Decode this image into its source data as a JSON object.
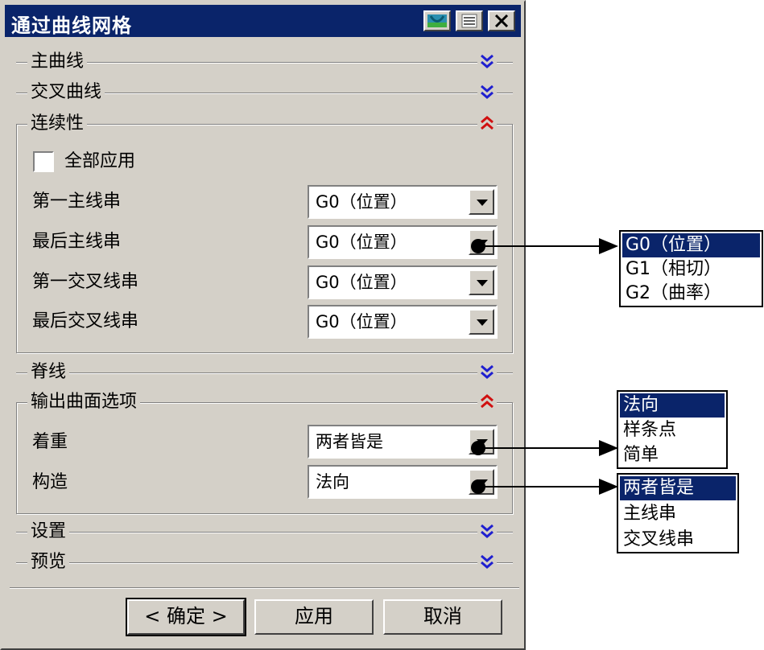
{
  "dialog": {
    "title": "通过曲线网格",
    "sections": {
      "primary": "主曲线",
      "cross": "交叉曲线",
      "continuity": "连续性",
      "spine": "脊线",
      "output": "输出曲面选项",
      "settings": "设置",
      "preview": "预览"
    },
    "continuity": {
      "apply_all_label": "全部应用",
      "apply_all_checked": false,
      "rows": [
        {
          "label": "第一主线串",
          "value": "G0（位置）"
        },
        {
          "label": "最后主线串",
          "value": "G0（位置）"
        },
        {
          "label": "第一交叉线串",
          "value": "G0（位置）"
        },
        {
          "label": "最后交叉线串",
          "value": "G0（位置）"
        }
      ]
    },
    "output": {
      "rows": [
        {
          "label": "着重",
          "value": "两者皆是"
        },
        {
          "label": "构造",
          "value": "法向"
        }
      ]
    },
    "buttons": {
      "ok": "< 确定 >",
      "apply": "应用",
      "cancel": "取消"
    }
  },
  "popups": {
    "continuity_options": [
      "G0（位置）",
      "G1（相切）",
      "G2（曲率）"
    ],
    "construction_options": [
      "法向",
      "样条点",
      "简单"
    ],
    "emphasis_options": [
      "两者皆是",
      "主线串",
      "交叉线串"
    ]
  },
  "colors": {
    "titlebar": "#0a246a",
    "selection": "#0a246a",
    "dialog_bg": "#d4d0c8",
    "chevron_collapsed": "#1f1fd0",
    "chevron_expanded": "#d01010"
  }
}
